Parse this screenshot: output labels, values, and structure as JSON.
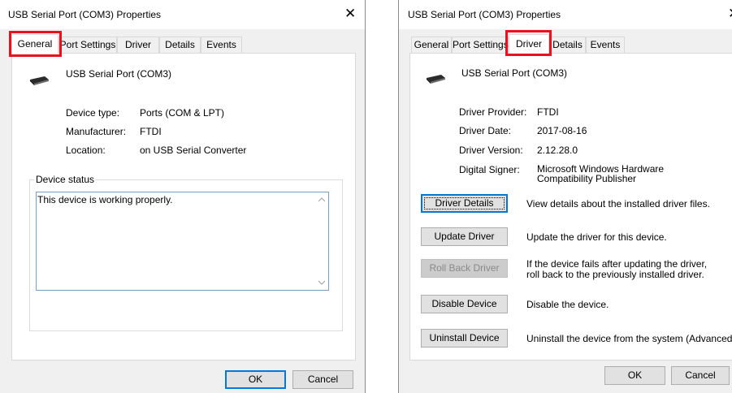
{
  "left": {
    "title": "USB Serial Port (COM3) Properties",
    "tabs": [
      "General",
      "Port Settings",
      "Driver",
      "Details",
      "Events"
    ],
    "active_tab": "General",
    "device_name": "USB Serial Port (COM3)",
    "props": [
      {
        "label": "Device type:",
        "value": "Ports (COM & LPT)"
      },
      {
        "label": "Manufacturer:",
        "value": "FTDI"
      },
      {
        "label": "Location:",
        "value": "on USB Serial Converter"
      }
    ],
    "status_legend": "Device status",
    "status_text": "This device is working properly.",
    "ok": "OK",
    "cancel": "Cancel"
  },
  "right": {
    "title": "USB Serial Port (COM3) Properties",
    "tabs": [
      "General",
      "Port Settings",
      "Driver",
      "Details",
      "Events"
    ],
    "active_tab": "Driver",
    "device_name": "USB Serial Port (COM3)",
    "props": [
      {
        "label": "Driver Provider:",
        "value": "FTDI"
      },
      {
        "label": "Driver Date:",
        "value": "2017-08-16"
      },
      {
        "label": "Driver Version:",
        "value": "2.12.28.0"
      },
      {
        "label": "Digital Signer:",
        "value": "Microsoft Windows Hardware Compatibility Publisher"
      }
    ],
    "actions": [
      {
        "button": "Driver Details",
        "desc": "View details about the installed driver files."
      },
      {
        "button": "Update Driver",
        "desc": "Update the driver for this device."
      },
      {
        "button": "Roll Back Driver",
        "desc": "If the device fails after updating the driver, roll back to the previously installed driver."
      },
      {
        "button": "Disable Device",
        "desc": "Disable the device."
      },
      {
        "button": "Uninstall Device",
        "desc": "Uninstall the device from the system (Advanced)."
      }
    ],
    "ok": "OK",
    "cancel": "Cancel"
  },
  "colors": {
    "highlight": "#e8121f",
    "focus": "#0078d7"
  },
  "icons": [
    "close-icon",
    "usb-device-icon",
    "scroll-up-icon",
    "scroll-down-icon"
  ]
}
